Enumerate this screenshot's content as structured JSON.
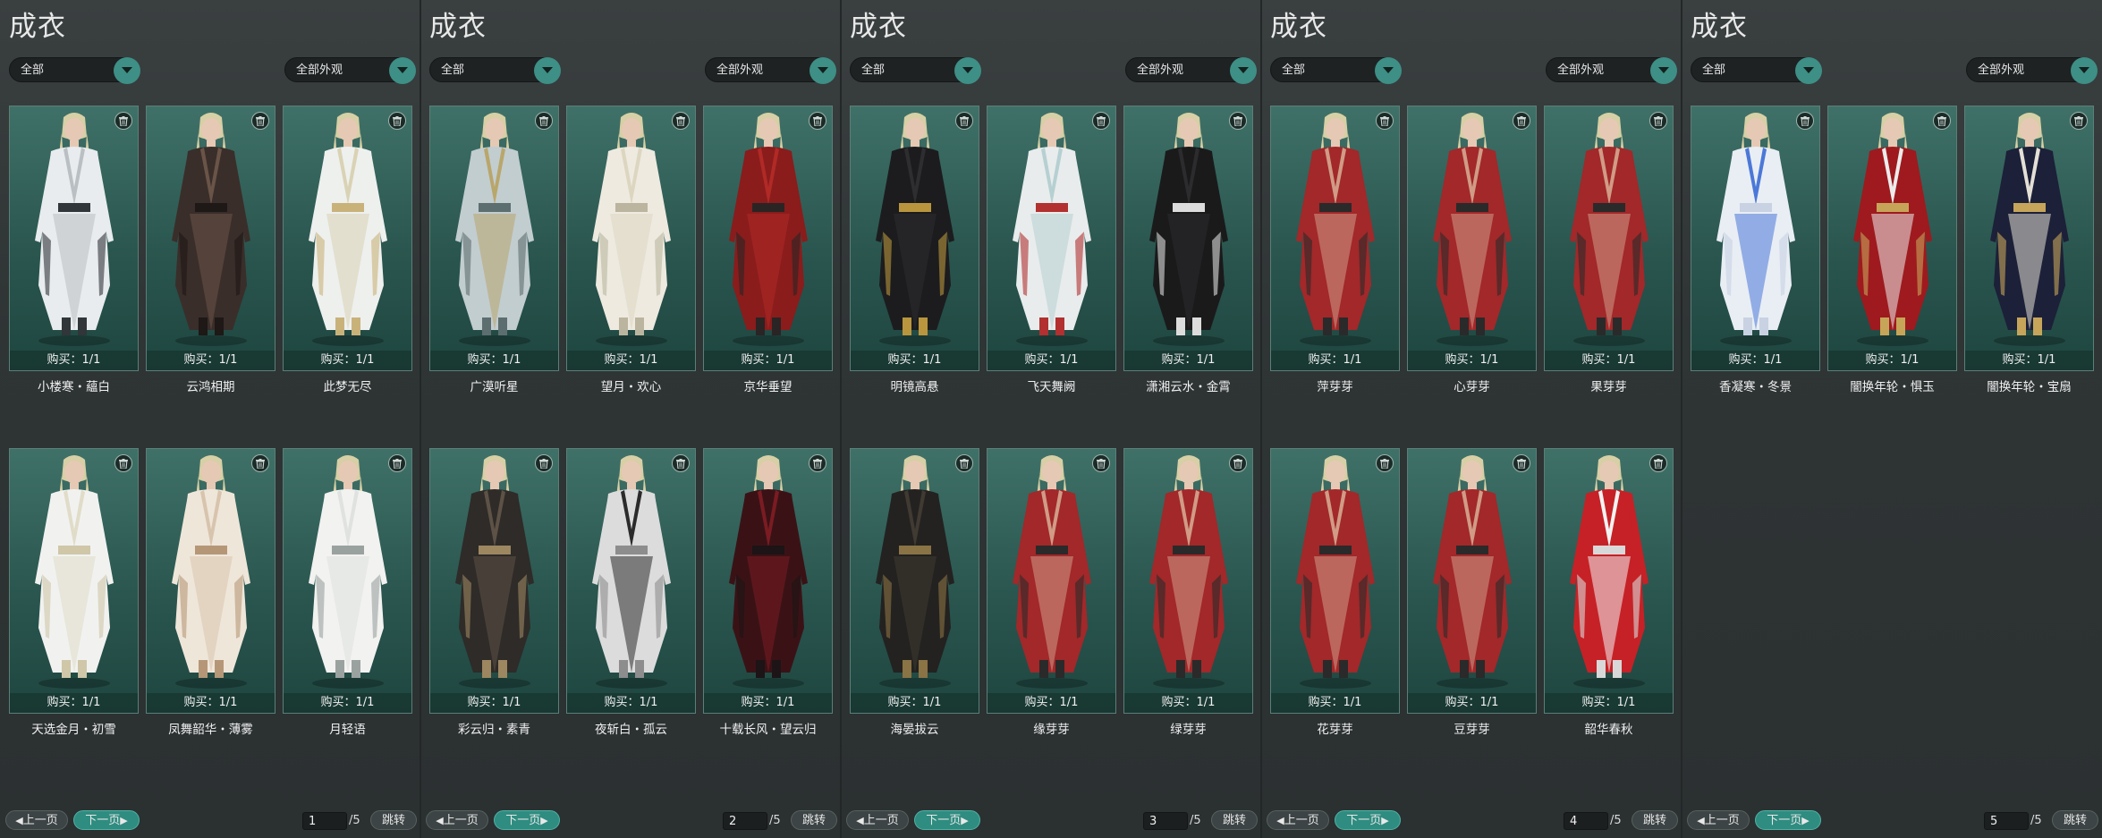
{
  "title": "成衣",
  "filters": {
    "category": "全部",
    "appearance": "全部外观"
  },
  "buttons": {
    "prev": "上一页",
    "next": "下一页",
    "jump": "跳转"
  },
  "page_total": "/5",
  "buy_prefix": "购买：",
  "pages": [
    {
      "page": "1",
      "items": [
        {
          "name": "小楼寒・蘊白",
          "buy": "购买：1/1",
          "colors": [
            "#e8ecee",
            "#b9bfc2",
            "#30363a"
          ]
        },
        {
          "name": "云鸿相期",
          "buy": "购买：1/1",
          "colors": [
            "#3a2e2a",
            "#6a5448",
            "#1e1816"
          ]
        },
        {
          "name": "此梦无尽",
          "buy": "购买：1/1",
          "colors": [
            "#eef0ee",
            "#d9d2b4",
            "#c9b27a"
          ]
        },
        {
          "name": "天选金月・初雪",
          "buy": "购买：1/1",
          "colors": [
            "#f1f2f0",
            "#e0dcc8",
            "#cfc7a8"
          ]
        },
        {
          "name": "凤舞韶华・薄雾",
          "buy": "购买：1/1",
          "colors": [
            "#efe6da",
            "#d8c4ad",
            "#b59777"
          ]
        },
        {
          "name": "月轻语",
          "buy": "购买：1/1",
          "colors": [
            "#f2f2f0",
            "#dfe2df",
            "#9aa2a0"
          ]
        }
      ]
    },
    {
      "page": "2",
      "items": [
        {
          "name": "广漠听星",
          "buy": "购买：1/1",
          "colors": [
            "#c2cdd0",
            "#b9a66b",
            "#5d6e70"
          ]
        },
        {
          "name": "望月・欢心",
          "buy": "购买：1/1",
          "colors": [
            "#eeeae0",
            "#dcd6c0",
            "#bbb59f"
          ]
        },
        {
          "name": "京华垂望",
          "buy": "购买：1/1",
          "colors": [
            "#8a1c1c",
            "#b02a26",
            "#2a2424"
          ]
        },
        {
          "name": "彩云归・素青",
          "buy": "购买：1/1",
          "colors": [
            "#2e2b28",
            "#5e5246",
            "#9c8760"
          ]
        },
        {
          "name": "夜斩白・孤云",
          "buy": "购买：1/1",
          "colors": [
            "#dcdcdc",
            "#2b2b2b",
            "#8d8d8d"
          ]
        },
        {
          "name": "十载长风・望云归",
          "buy": "购买：1/1",
          "colors": [
            "#3a1216",
            "#7a1c22",
            "#1c1416"
          ]
        }
      ]
    },
    {
      "page": "3",
      "items": [
        {
          "name": "明镜高悬",
          "buy": "购买：1/1",
          "colors": [
            "#1c1c1e",
            "#2e2e30",
            "#b9963e"
          ]
        },
        {
          "name": "飞天舞阙",
          "buy": "购买：1/1",
          "colors": [
            "#e9ecec",
            "#b6d0d2",
            "#b23030"
          ]
        },
        {
          "name": "潇湘云水・金霄",
          "buy": "购买：1/1",
          "colors": [
            "#1a1a1b",
            "#2c2c2e",
            "#dcdcdc"
          ]
        },
        {
          "name": "海晏拔云",
          "buy": "购买：1/1",
          "colors": [
            "#232220",
            "#403a32",
            "#8a7345"
          ]
        },
        {
          "name": "缘芽芽",
          "buy": "购买：1/1",
          "colors": [
            "#a2282a",
            "#d19b86",
            "#2a2a2a"
          ]
        },
        {
          "name": "绿芽芽",
          "buy": "购买：1/1",
          "colors": [
            "#a2282a",
            "#d19b86",
            "#2a2a2a"
          ]
        }
      ]
    },
    {
      "page": "4",
      "items": [
        {
          "name": "萍芽芽",
          "buy": "购买：1/1",
          "colors": [
            "#a2282a",
            "#d19b86",
            "#2a2a2a"
          ]
        },
        {
          "name": "心芽芽",
          "buy": "购买：1/1",
          "colors": [
            "#a2282a",
            "#d19b86",
            "#2a2a2a"
          ]
        },
        {
          "name": "果芽芽",
          "buy": "购买：1/1",
          "colors": [
            "#a2282a",
            "#d19b86",
            "#2a2a2a"
          ]
        },
        {
          "name": "花芽芽",
          "buy": "购买：1/1",
          "colors": [
            "#a2282a",
            "#d19b86",
            "#2a2a2a"
          ]
        },
        {
          "name": "豆芽芽",
          "buy": "购买：1/1",
          "colors": [
            "#a2282a",
            "#d19b86",
            "#2a2a2a"
          ]
        },
        {
          "name": "韶华春秋",
          "buy": "购买：1/1",
          "colors": [
            "#c62126",
            "#f2f2f2",
            "#d8d8d8"
          ]
        }
      ]
    },
    {
      "page": "5",
      "items": [
        {
          "name": "香凝寒・冬景",
          "buy": "购买：1/1",
          "colors": [
            "#e9eef4",
            "#4b78d8",
            "#c8d2e2"
          ]
        },
        {
          "name": "闇换年轮・惧玉",
          "buy": "购买：1/1",
          "colors": [
            "#9e1a1e",
            "#ececec",
            "#c7a558"
          ]
        },
        {
          "name": "闇换年轮・宝扇",
          "buy": "购买：1/1",
          "colors": [
            "#1c2038",
            "#e4e0d6",
            "#c6a55a"
          ]
        }
      ]
    }
  ],
  "colors": {
    "accent": "#3e8f86",
    "card_bg": "#2a564f"
  }
}
